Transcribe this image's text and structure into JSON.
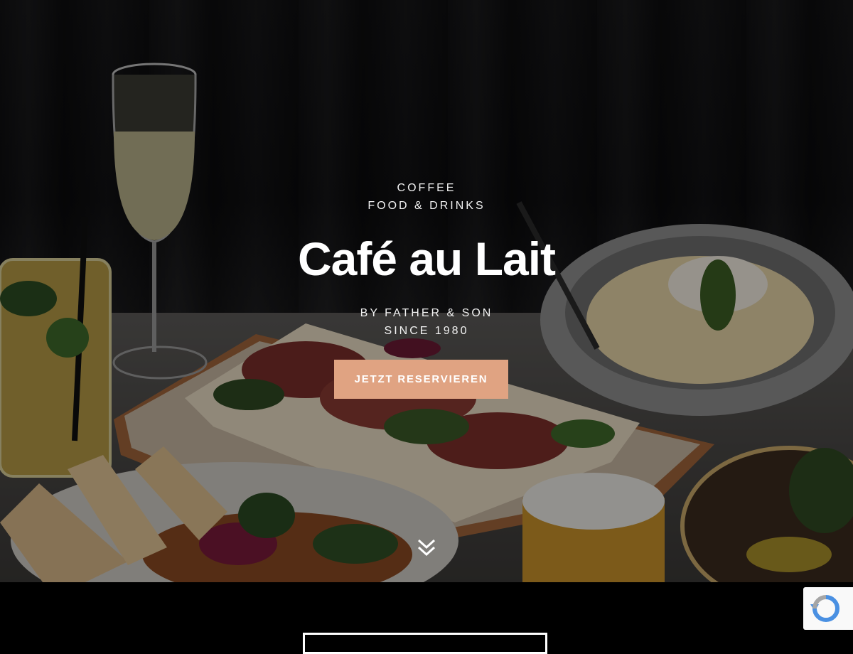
{
  "hero": {
    "tagline_top": [
      "COFFEE",
      "FOOD & DRINKS"
    ],
    "title": "Café au Lait",
    "tagline_bottom": [
      "BY FATHER & SON",
      "SINCE 1980"
    ],
    "cta_label": "JETZT RESERVIEREN",
    "scroll_icon": "double-chevron-down-icon"
  },
  "colors": {
    "accent": "#e0a382",
    "overlay": "#000000",
    "text": "#ffffff"
  },
  "recaptcha": {
    "icon": "recaptcha-icon"
  }
}
